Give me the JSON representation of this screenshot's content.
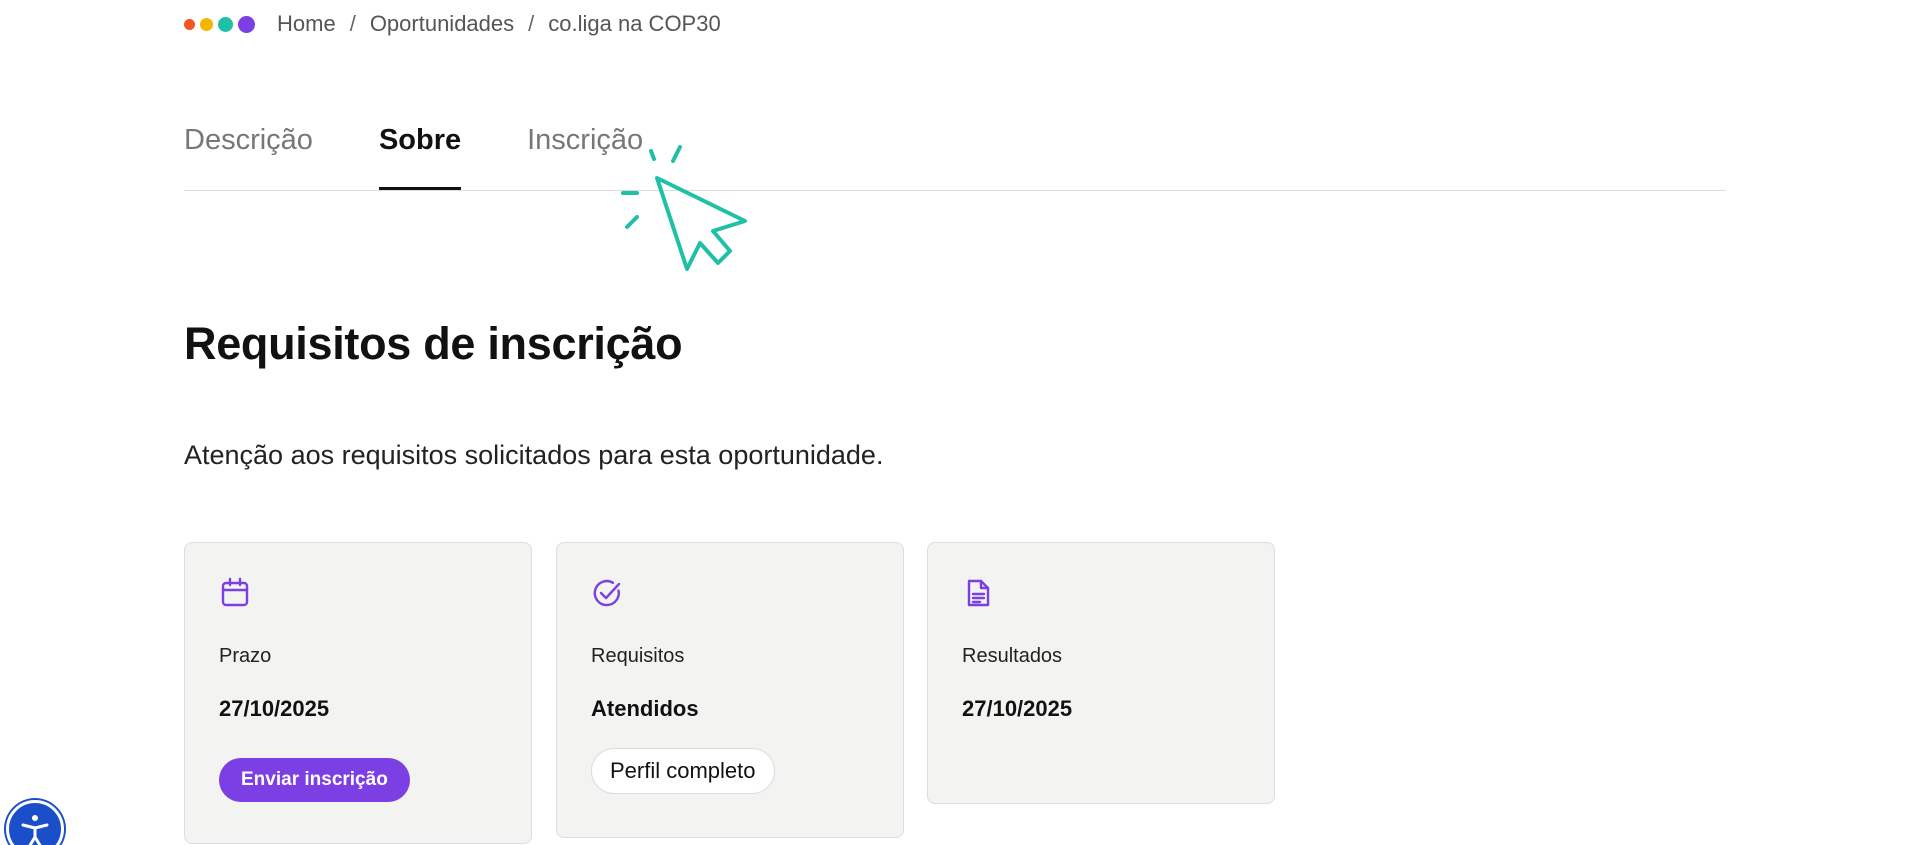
{
  "breadcrumb": {
    "dots_colors": [
      "#f2551f",
      "#f7b500",
      "#1fc0a8",
      "#7b3fe4"
    ],
    "items": [
      "Home",
      "Oportunidades",
      "co.liga na COP30"
    ],
    "separator": "/"
  },
  "tabs": [
    {
      "label": "Descrição",
      "active": false
    },
    {
      "label": "Sobre",
      "active": true
    },
    {
      "label": "Inscrição",
      "active": false
    }
  ],
  "section": {
    "title": "Requisitos de inscrição",
    "subtitle": "Atenção aos requisitos solicitados para esta oportunidade."
  },
  "cards": [
    {
      "icon": "calendar-icon",
      "label": "Prazo",
      "value": "27/10/2025",
      "button_label": "Enviar inscrição"
    },
    {
      "icon": "check-circle-icon",
      "label": "Requisitos",
      "value": "Atendidos",
      "pill_label": "Perfil completo"
    },
    {
      "icon": "document-icon",
      "label": "Resultados",
      "value": "27/10/2025"
    }
  ],
  "colors": {
    "accent": "#7b3fe4",
    "cursor": "#1fc0a8",
    "card_bg": "#f3f3f2",
    "a11y": "#1a4fc9"
  },
  "accessibility": {
    "icon": "accessibility-icon"
  }
}
